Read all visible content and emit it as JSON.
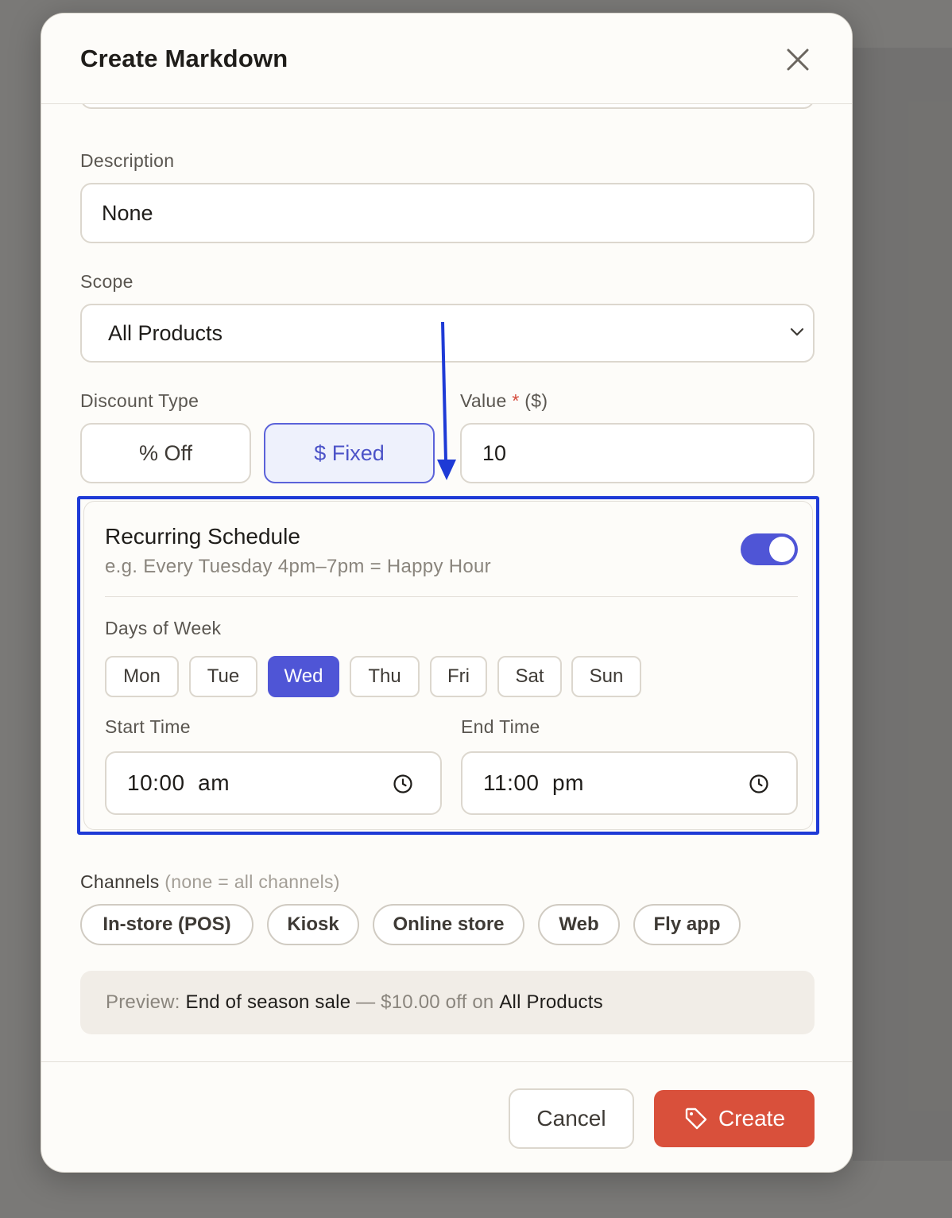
{
  "modal": {
    "title": "Create Markdown"
  },
  "form": {
    "description": {
      "label": "Description",
      "value": "None"
    },
    "scope": {
      "label": "Scope",
      "selected": "All Products"
    },
    "discount_type": {
      "label": "Discount Type",
      "options": [
        "% Off",
        "$ Fixed"
      ],
      "selected": "$ Fixed"
    },
    "value": {
      "label": "Value",
      "required_mark": "*",
      "unit": "($)",
      "value": "10"
    }
  },
  "schedule": {
    "title": "Recurring Schedule",
    "subtitle": "e.g. Every Tuesday 4pm–7pm = Happy Hour",
    "enabled": true,
    "days_label": "Days of Week",
    "days": [
      "Mon",
      "Tue",
      "Wed",
      "Thu",
      "Fri",
      "Sat",
      "Sun"
    ],
    "selected_day": "Wed",
    "start": {
      "label": "Start Time",
      "value": "10:00  am"
    },
    "end": {
      "label": "End Time",
      "value": "11:00  pm"
    }
  },
  "channels": {
    "label": "Channels",
    "hint": "(none = all channels)",
    "options": [
      "In-store (POS)",
      "Kiosk",
      "Online store",
      "Web",
      "Fly app"
    ]
  },
  "preview": {
    "prefix": "Preview: ",
    "name": "End of season sale",
    "middle": " — $10.00 off on ",
    "scope": "All Products"
  },
  "footer": {
    "cancel_label": "Cancel",
    "create_label": "Create"
  },
  "colors": {
    "accent": "#4f55d6",
    "primary_button": "#d9503b",
    "annotation": "#1e3ad6"
  },
  "icons": {
    "close": "close-icon",
    "chevron": "chevron-down-icon",
    "clock": "clock-icon",
    "tag": "tag-icon"
  }
}
